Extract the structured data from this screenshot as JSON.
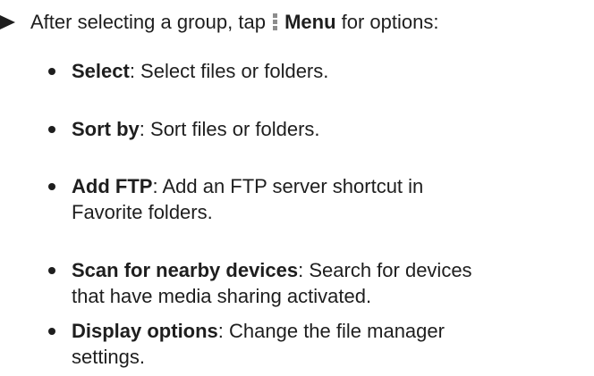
{
  "intro": {
    "before": "After selecting a group, tap",
    "menu_label": "Menu",
    "after": "for options:"
  },
  "options": [
    {
      "title": "Select",
      "desc": ": Select files or folders.",
      "desc2": ""
    },
    {
      "title": "Sort by",
      "desc": ": Sort files or folders.",
      "desc2": ""
    },
    {
      "title": "Add FTP",
      "desc": ": Add an FTP server shortcut in",
      "desc2": "Favorite folders."
    },
    {
      "title": "Scan for nearby devices",
      "desc": ": Search for devices",
      "desc2": "that have media sharing activated."
    },
    {
      "title": "Display options",
      "desc": ": Change the file manager",
      "desc2": "settings."
    }
  ]
}
